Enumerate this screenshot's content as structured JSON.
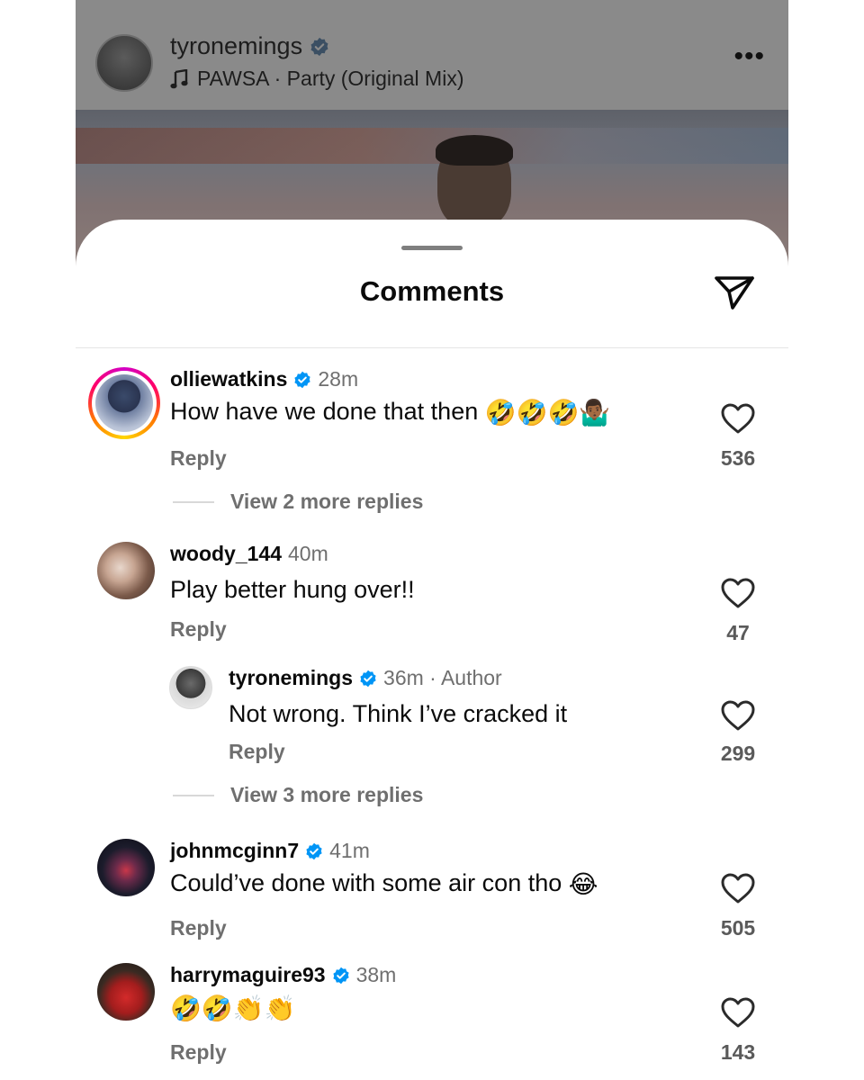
{
  "post": {
    "username": "tyronemings",
    "music": "PAWSA · Party (Original Mix)",
    "more": "•••"
  },
  "sheet": {
    "title": "Comments"
  },
  "comments": [
    {
      "username": "olliewatkins",
      "verified": true,
      "time": "28m",
      "text": "How have we done that then",
      "emoji": "🤣🤣🤣🤷🏾‍♂️",
      "reply": "Reply",
      "likes": "536",
      "view_more": "View 2 more replies"
    },
    {
      "username": "woody_144",
      "verified": false,
      "time": "40m",
      "text": "Play better hung over!!",
      "reply": "Reply",
      "likes": "47"
    },
    {
      "username": "tyronemings",
      "verified": true,
      "time": "36m · Author",
      "text": "Not wrong. Think I’ve cracked it",
      "reply": "Reply",
      "likes": "299",
      "view_more": "View 3 more replies"
    },
    {
      "username": "johnmcginn7",
      "verified": true,
      "time": "41m",
      "text": "Could’ve done with some air con tho",
      "emoji": "😂",
      "reply": "Reply",
      "likes": "505"
    },
    {
      "username": "harrymaguire93",
      "verified": true,
      "time": "38m",
      "text": "",
      "emoji": "🤣🤣👏👏",
      "reply": "Reply",
      "likes": "143"
    }
  ],
  "icons": {
    "music": "music-note-icon",
    "more": "more-horizontal-icon",
    "share": "paper-plane-icon",
    "like": "heart-outline-icon",
    "verified": "verified-badge-icon"
  },
  "colors": {
    "verified_blue": "#0095f6",
    "secondary_text": "#6f6f6f",
    "story_ring_start": "#d300c5",
    "story_ring_end": "#ffd600"
  }
}
